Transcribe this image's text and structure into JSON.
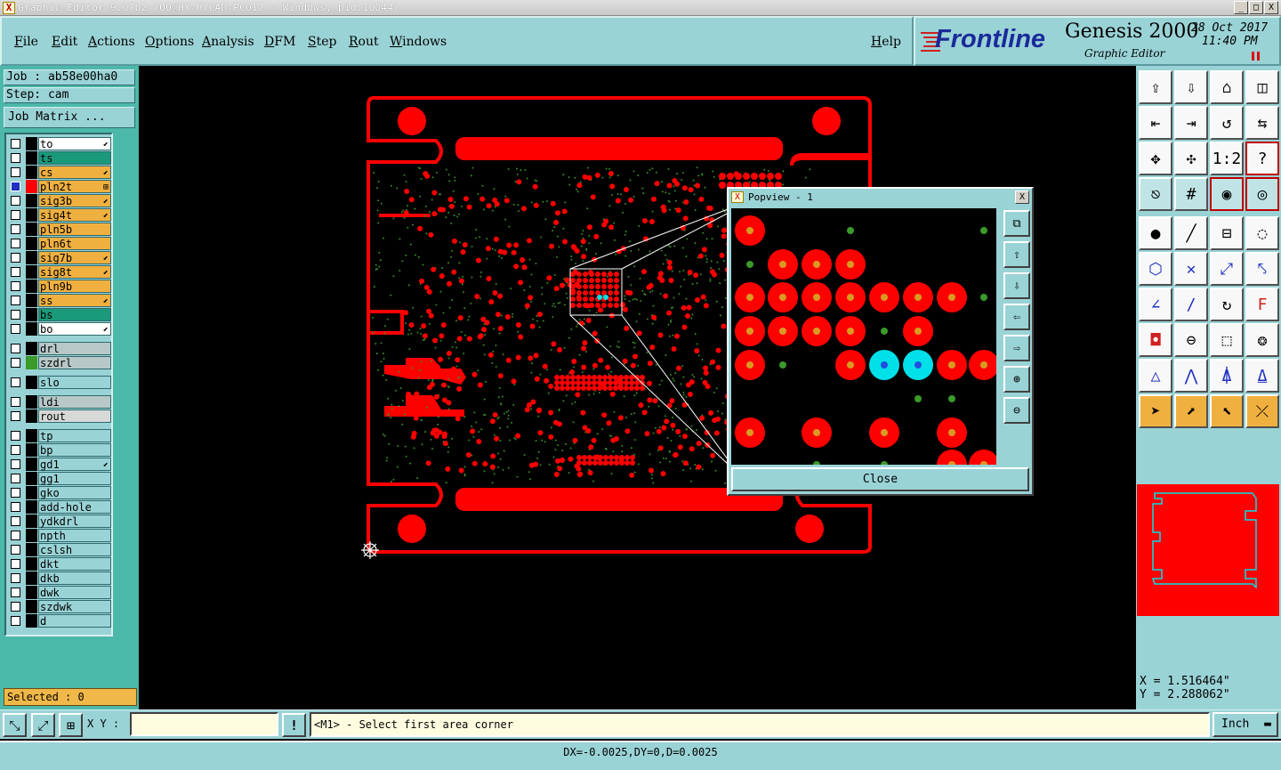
{
  "window": {
    "title": "Graphic Editor 9.07b2 (OO@HY-HYCAM-PC017 - Windows, pid:10044)",
    "minimize": "_",
    "maximize": "□",
    "close": "X"
  },
  "menu": [
    "File",
    "Edit",
    "Actions",
    "Options",
    "Analysis",
    "DFM",
    "Step",
    "Rout",
    "Windows"
  ],
  "help": "Help",
  "brand": {
    "logo": "Frontline",
    "product": "Genesis 2000",
    "subtitle": "Graphic Editor",
    "date": "28 Oct 2017",
    "time": "11:40 PM"
  },
  "job": {
    "job_label": "Job : ab58e00ha0",
    "step_label": "Step: cam",
    "matrix_button": "Job Matrix ..."
  },
  "layers": [
    {
      "name": "to",
      "color": "#ffffff",
      "mark": "⬋"
    },
    {
      "name": "ts",
      "color": "#1a9a7a",
      "mark": ""
    },
    {
      "name": "cs",
      "color": "#f0b040",
      "mark": "⬋"
    },
    {
      "name": "pln2t",
      "color": "#f0b040",
      "mark": "⊞",
      "active": true
    },
    {
      "name": "sig3b",
      "color": "#f0b040",
      "mark": "⬋"
    },
    {
      "name": "sig4t",
      "color": "#f0b040",
      "mark": "⬋"
    },
    {
      "name": "pln5b",
      "color": "#f0b040",
      "mark": ""
    },
    {
      "name": "pln6t",
      "color": "#f0b040",
      "mark": ""
    },
    {
      "name": "sig7b",
      "color": "#f0b040",
      "mark": "⬋"
    },
    {
      "name": "sig8t",
      "color": "#f0b040",
      "mark": "⬋"
    },
    {
      "name": "pln9b",
      "color": "#f0b040",
      "mark": ""
    },
    {
      "name": "ss",
      "color": "#f0b040",
      "mark": "⬋"
    },
    {
      "name": "bs",
      "color": "#1a9a7a",
      "mark": ""
    },
    {
      "name": "bo",
      "color": "#ffffff",
      "mark": "⬋"
    },
    {
      "name": "drl",
      "color": "#b8c8c8",
      "mark": ""
    },
    {
      "name": "szdrl",
      "color": "#b8c8c8",
      "mark": ""
    },
    {
      "name": "slo",
      "color": "#9ad3d6",
      "mark": ""
    },
    {
      "name": "ldi",
      "color": "#b8c8c8",
      "mark": ""
    },
    {
      "name": "rout",
      "color": "#d8d8d8",
      "mark": ""
    },
    {
      "name": "tp",
      "color": "#9ad3d6",
      "mark": ""
    },
    {
      "name": "bp",
      "color": "#9ad3d6",
      "mark": ""
    },
    {
      "name": "gd1",
      "color": "#9ad3d6",
      "mark": "⬋"
    },
    {
      "name": "gg1",
      "color": "#9ad3d6",
      "mark": ""
    },
    {
      "name": "gko",
      "color": "#9ad3d6",
      "mark": ""
    },
    {
      "name": "add-hole",
      "color": "#9ad3d6",
      "mark": ""
    },
    {
      "name": "ydkdrl",
      "color": "#9ad3d6",
      "mark": ""
    },
    {
      "name": "npth",
      "color": "#9ad3d6",
      "mark": ""
    },
    {
      "name": "cslsh",
      "color": "#9ad3d6",
      "mark": ""
    },
    {
      "name": "dkt",
      "color": "#9ad3d6",
      "mark": ""
    },
    {
      "name": "dkb",
      "color": "#9ad3d6",
      "mark": ""
    },
    {
      "name": "dwk",
      "color": "#9ad3d6",
      "mark": ""
    },
    {
      "name": "szdwk",
      "color": "#9ad3d6",
      "mark": ""
    },
    {
      "name": "d",
      "color": "#9ad3d6",
      "mark": ""
    }
  ],
  "selected": "Selected : 0",
  "coords": {
    "x": "X = 1.516464\"",
    "y": "Y = 2.288062\""
  },
  "bottom": {
    "xy_label": "X Y :",
    "xy_value": "",
    "warn": "!",
    "prompt": "<M1> - Select first area corner",
    "units": "Inch"
  },
  "status": "DX=-0.0025,DY=0,D=0.0025",
  "popview": {
    "title": "Popview - 1",
    "close_button": "Close"
  },
  "colors": {
    "panel": "#9ad3d6",
    "pad": "#ff0000",
    "accent": "#f0b040",
    "highlight": "#00e0e8"
  }
}
